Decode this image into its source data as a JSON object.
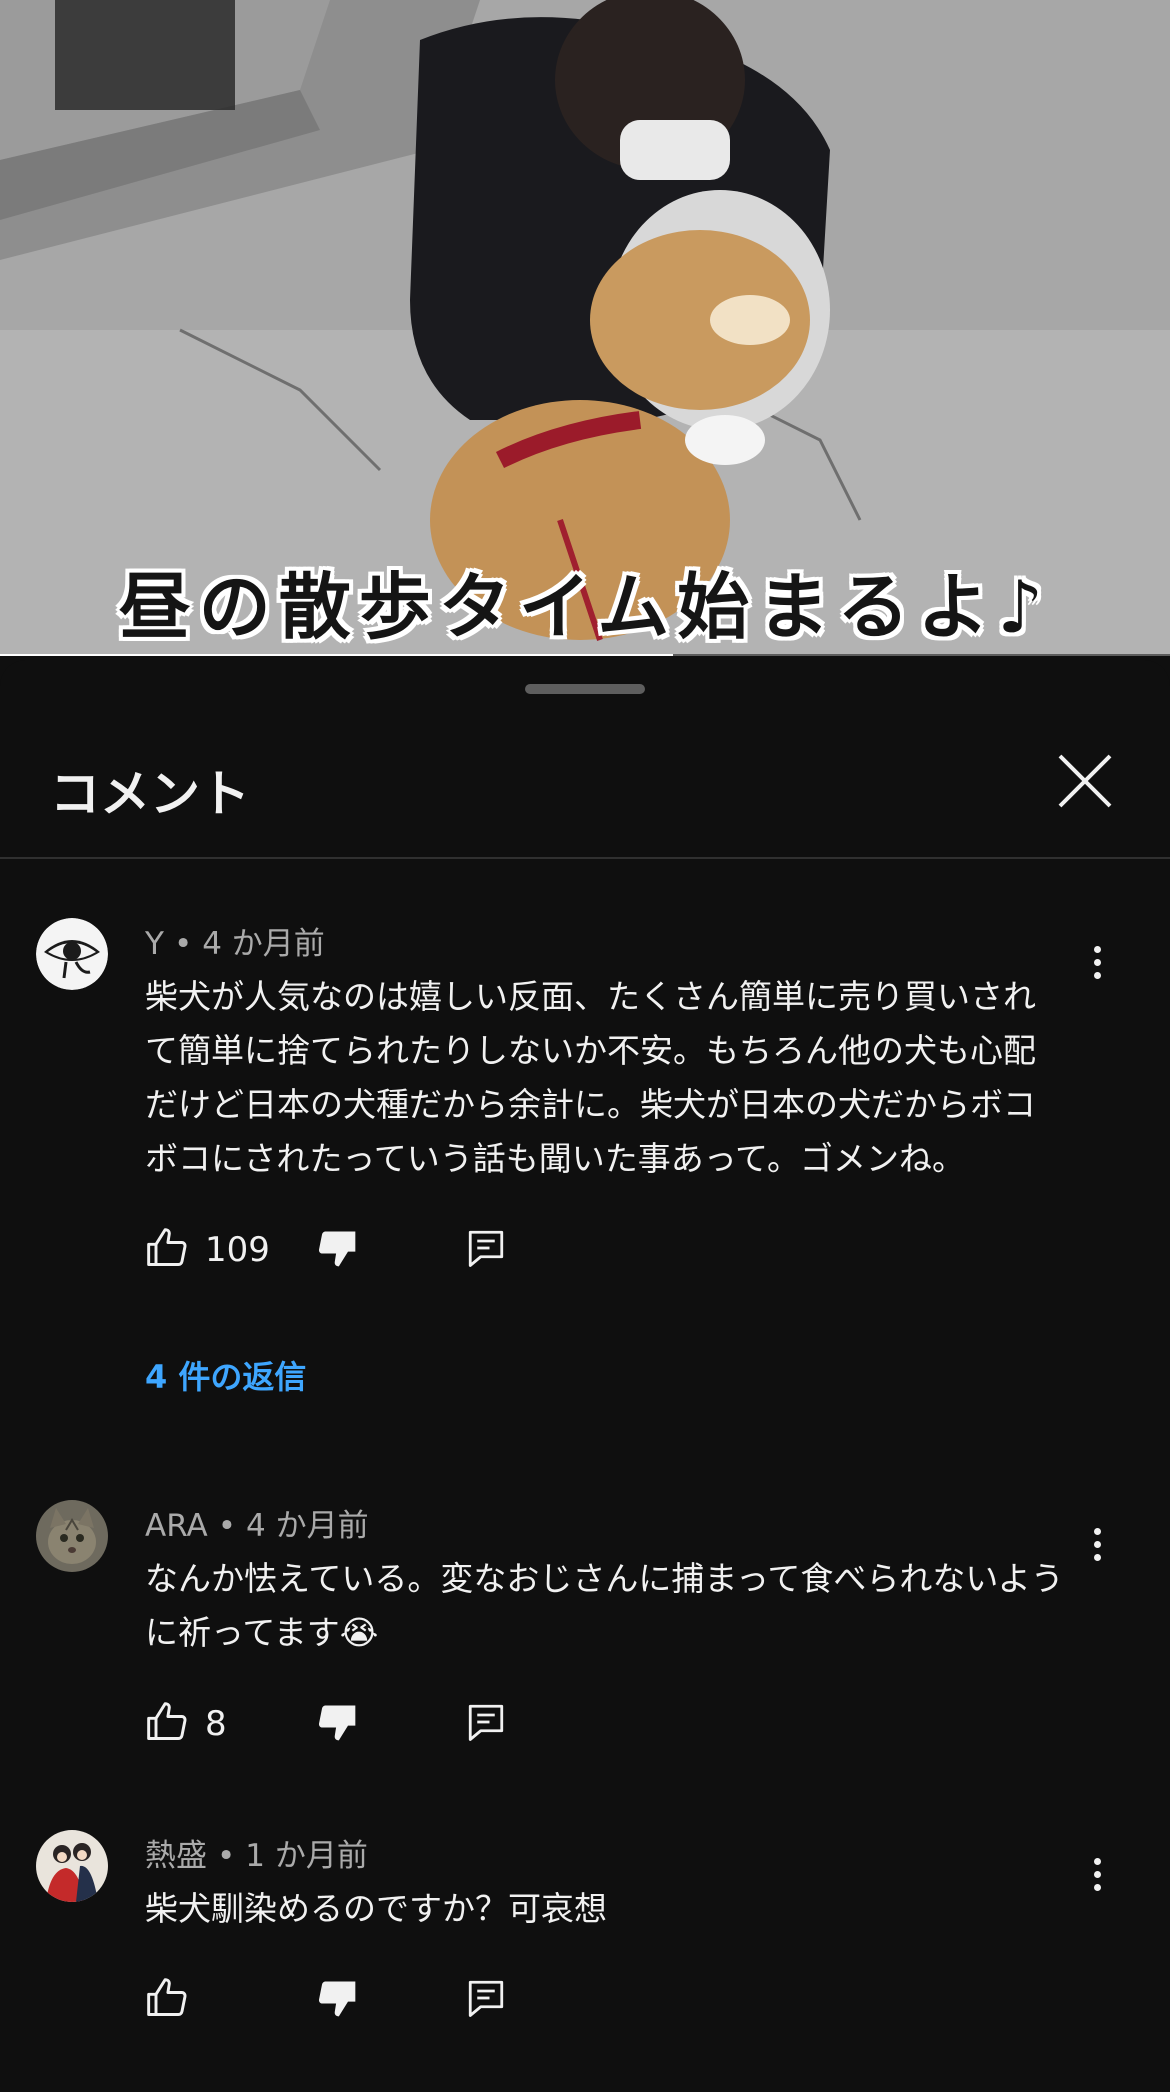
{
  "video": {
    "caption": "昼の散歩タイム始まるよ♪",
    "progress_fraction": 0.575
  },
  "sheet": {
    "title": "コメント",
    "close_icon": "close-icon"
  },
  "comments": [
    {
      "author": "Y",
      "separator": "•",
      "time": "4 か月前",
      "text": "柴犬が人気なのは嬉しい反面、たくさん簡単に売り買いされて簡単に捨てられたりしないか不安。もちろん他の犬も心配だけど日本の犬種だから余計に。柴犬が日本の犬だからボコボコにされたっていう話も聞いた事あって。ゴメンね。",
      "likes": "109",
      "replies_label": "4 件の返信"
    },
    {
      "author": "ARA",
      "separator": "•",
      "time": "4 か月前",
      "text": "なんか怯えている。変なおじさんに捕まって食べられないように祈ってます😭",
      "likes": "8"
    },
    {
      "author": "熱盛",
      "separator": "•",
      "time": "1 か月前",
      "text": "柴犬馴染めるのですか？可哀想",
      "likes": ""
    }
  ],
  "icons": {
    "like": "thumb-up-icon",
    "dislike": "thumb-down-icon",
    "reply": "reply-icon",
    "more": "more-vert-icon"
  },
  "colors": {
    "background": "#0f0f0f",
    "text": "#f1f1f1",
    "meta": "#aaaaaa",
    "link": "#3ea6ff"
  }
}
